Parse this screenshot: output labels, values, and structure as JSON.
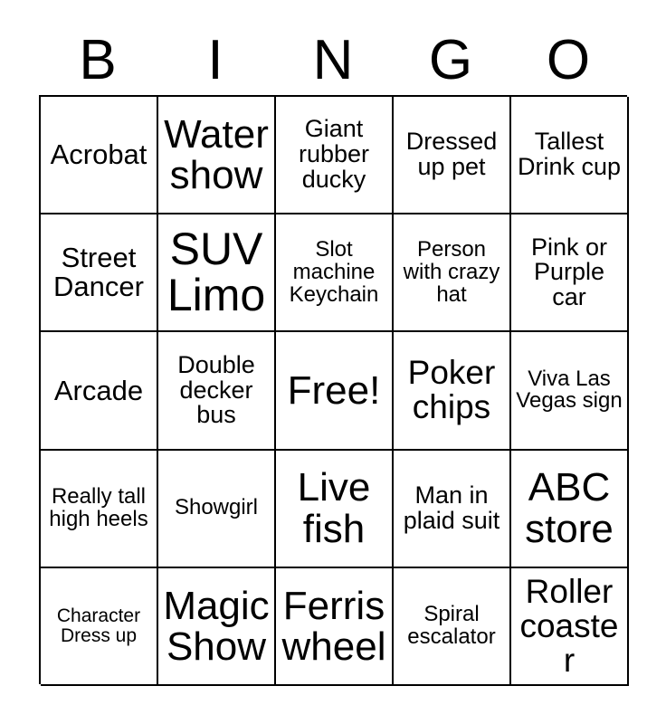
{
  "card": {
    "header_letters": [
      "B",
      "I",
      "N",
      "G",
      "O"
    ],
    "colors": {
      "background": "#ffffff",
      "text": "#000000",
      "grid_line": "#000000"
    },
    "rows": [
      [
        {
          "text": "Acrobat",
          "size": "lg"
        },
        {
          "text": "Water show",
          "size": "xxl"
        },
        {
          "text": "Giant rubber ducky",
          "size": "md"
        },
        {
          "text": "Dressed up pet",
          "size": "md"
        },
        {
          "text": "Tallest Drink cup",
          "size": "md"
        }
      ],
      [
        {
          "text": "Street Dancer",
          "size": "lg"
        },
        {
          "text": "SUV Limo",
          "size": "huge"
        },
        {
          "text": "Slot machine Keychain",
          "size": "sm"
        },
        {
          "text": "Person with crazy hat",
          "size": "sm"
        },
        {
          "text": "Pink or Purple car",
          "size": "md"
        }
      ],
      [
        {
          "text": "Arcade",
          "size": "lg"
        },
        {
          "text": "Double decker bus",
          "size": "md"
        },
        {
          "text": "Free!",
          "size": "xxl"
        },
        {
          "text": "Poker chips",
          "size": "xl"
        },
        {
          "text": "Viva Las Vegas sign",
          "size": "sm"
        }
      ],
      [
        {
          "text": "Really tall high heels",
          "size": "sm"
        },
        {
          "text": "Showgirl",
          "size": "sm"
        },
        {
          "text": "Live fish",
          "size": "xxl"
        },
        {
          "text": "Man in plaid suit",
          "size": "md"
        },
        {
          "text": "ABC store",
          "size": "xxl"
        }
      ],
      [
        {
          "text": "Character Dress up",
          "size": "xs"
        },
        {
          "text": "Magic Show",
          "size": "xxl"
        },
        {
          "text": "Ferris wheel",
          "size": "xxl"
        },
        {
          "text": "Spiral escalator",
          "size": "sm"
        },
        {
          "text": "Roller coaster",
          "size": "xl"
        }
      ]
    ]
  }
}
